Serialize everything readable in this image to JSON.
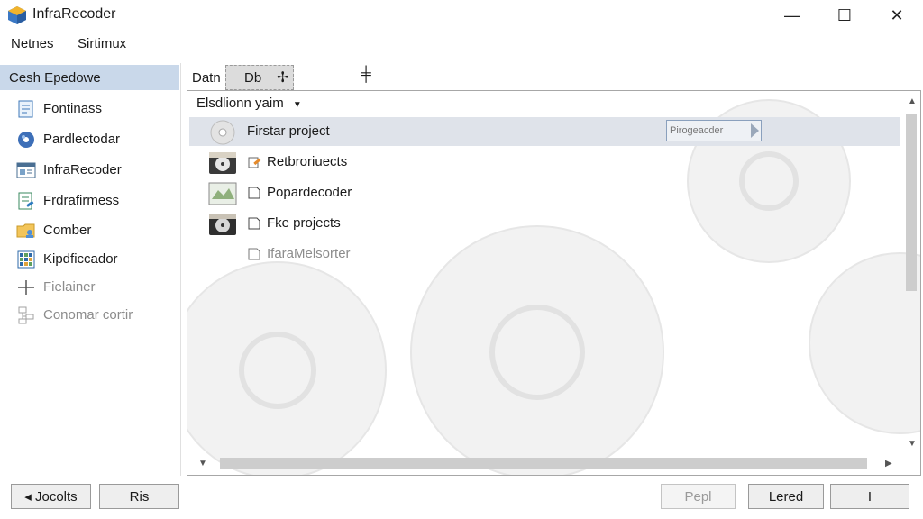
{
  "window": {
    "title": "InfraRecoder",
    "controls": {
      "minimize": "—",
      "maximize": "☐",
      "close": "✕"
    }
  },
  "menu": [
    "Netnes",
    "Sirtimux"
  ],
  "sidebar": {
    "header": "Cesh Epedowe",
    "items": [
      {
        "label": "Fontinass",
        "icon": "document-icon",
        "enabled": true
      },
      {
        "label": "Pardlectodar",
        "icon": "disc-burner-icon",
        "enabled": true
      },
      {
        "label": "InfraRecoder",
        "icon": "window-icon",
        "enabled": true
      },
      {
        "label": "Frdrafirmess",
        "icon": "doc-edit-icon",
        "enabled": true
      },
      {
        "label": "Comber",
        "icon": "folder-user-icon",
        "enabled": true
      },
      {
        "label": "Kipdficcador",
        "icon": "grid-icon",
        "enabled": true
      },
      {
        "label": "Fielainer",
        "icon": "plus-icon",
        "enabled": false
      },
      {
        "label": "Conomar cortir",
        "icon": "tree-icon",
        "enabled": false
      }
    ]
  },
  "tabs": [
    {
      "label": "Datn",
      "active": false
    },
    {
      "label": "Db",
      "active": true,
      "icon": "pin-icon"
    },
    {
      "label": "",
      "icon": "pin-icon-2"
    }
  ],
  "list": {
    "header": "Elsdlionn yaim",
    "rows": [
      {
        "label": "Firstar project",
        "icon": "cd-icon",
        "selected": true,
        "badge": "Pirogeacder"
      },
      {
        "label": "Retbroriuects",
        "icon": "disc-drive-icon"
      },
      {
        "label": "Popardecoder",
        "icon": "disc-image-icon"
      },
      {
        "label": "Fke projects",
        "icon": "disc-drive-dark-icon"
      },
      {
        "label": "IfaraMelsorter",
        "icon": "",
        "dim": true
      }
    ]
  },
  "footer": {
    "left": [
      "◂ Jocolts",
      "Ris"
    ],
    "right": [
      {
        "label": "Pepl",
        "enabled": false
      },
      {
        "label": "Lered",
        "enabled": true
      },
      {
        "label": "I",
        "enabled": true
      }
    ]
  },
  "colors": {
    "selection": "#dfe3ea",
    "sidebar_header": "#c9d8ea",
    "border": "#a7a7a7"
  }
}
